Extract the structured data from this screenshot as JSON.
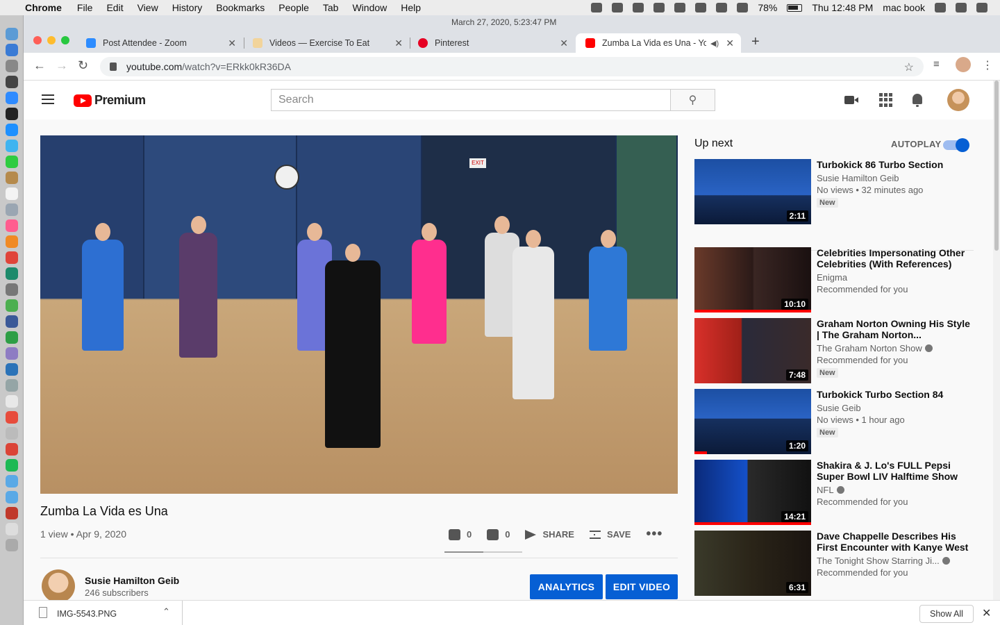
{
  "menubar": {
    "app_name": "Chrome",
    "items": [
      "File",
      "Edit",
      "View",
      "History",
      "Bookmarks",
      "People",
      "Tab",
      "Window",
      "Help"
    ],
    "battery": "78%",
    "clock": "Thu 12:48 PM",
    "user": "mac book"
  },
  "screenshot_stamp": "March 27, 2020, 5:23:47 PM",
  "tabs": [
    {
      "title": "Post Attendee - Zoom",
      "color": "#2d8cff"
    },
    {
      "title": "Videos — Exercise To Eat",
      "color": "#f2d49b"
    },
    {
      "title": "Pinterest",
      "color": "#e60023"
    },
    {
      "title": "Zumba La Vida es Una - Yo",
      "color": "#ff0000"
    }
  ],
  "url": {
    "host": "youtube.com",
    "path": "/watch?v=ERkk0kR36DA"
  },
  "youtube": {
    "logo_text": "Premium",
    "search_placeholder": "Search"
  },
  "video": {
    "title": "Zumba La Vida es Una",
    "meta": "1 view • Apr 9, 2020",
    "likes": "0",
    "dislikes": "0",
    "share_label": "SHARE",
    "save_label": "SAVE",
    "clock_text": "EXIT"
  },
  "owner": {
    "name": "Susie Hamilton Geib",
    "subscribers": "246 subscribers",
    "analytics_label": "ANALYTICS",
    "edit_label": "EDIT VIDEO"
  },
  "sidebar": {
    "up_next": "Up next",
    "autoplay": "AUTOPLAY",
    "autoplay_on": true,
    "items": [
      {
        "title": "Turbokick 86 Turbo Section",
        "channel": "Susie Hamilton Geib",
        "sub": "No views • 32 minutes ago",
        "badge": "New",
        "duration": "2:11"
      },
      {
        "title": "Celebrities Impersonating Other Celebrities (With References)",
        "channel": "Enigma",
        "sub": "Recommended for you",
        "badge": "",
        "duration": "10:10"
      },
      {
        "title": "Graham Norton Owning His Style | The Graham Norton...",
        "channel": "The Graham Norton Show",
        "sub": "Recommended for you",
        "badge": "New",
        "duration": "7:48"
      },
      {
        "title": "Turbokick Turbo Section 84",
        "channel": "Susie Geib",
        "sub": "No views • 1 hour ago",
        "badge": "New",
        "duration": "1:20"
      },
      {
        "title": "Shakira & J. Lo's FULL Pepsi Super Bowl LIV Halftime Show",
        "channel": "NFL",
        "sub": "Recommended for you",
        "badge": "",
        "duration": "14:21"
      },
      {
        "title": "Dave Chappelle Describes His First Encounter with Kanye West",
        "channel": "The Tonight Show Starring Ji...",
        "sub": "Recommended for you",
        "badge": "",
        "duration": "6:31"
      }
    ]
  },
  "downloads": {
    "file": "IMG-5543.PNG",
    "show_all": "Show All"
  }
}
